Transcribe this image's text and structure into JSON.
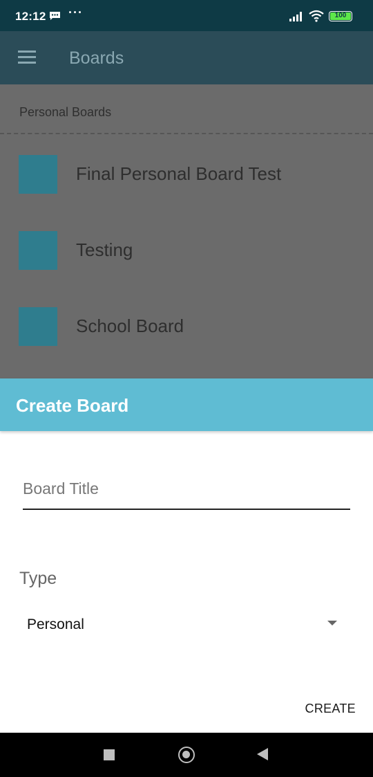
{
  "status_bar": {
    "time": "12:12",
    "more": "···",
    "battery": "100",
    "icons": [
      "message-icon",
      "signal-icon",
      "wifi-icon",
      "battery-icon"
    ]
  },
  "app_bar": {
    "title": "Boards",
    "menu_icon": "hamburger-menu-icon"
  },
  "boards": {
    "section_title": "Personal Boards",
    "items": [
      {
        "label": "Final Personal Board Test"
      },
      {
        "label": "Testing"
      },
      {
        "label": "School Board"
      }
    ],
    "swatch_color": "#2f7d8e"
  },
  "dialog": {
    "title": "Create Board",
    "title_field": {
      "value": "",
      "placeholder": "Board Title"
    },
    "type_label": "Type",
    "type_selected": "Personal",
    "create_label": "CREATE",
    "header_color": "#5fbcd3"
  },
  "nav_bar": {
    "icons": [
      "recent-apps-icon",
      "home-icon",
      "back-icon"
    ]
  }
}
